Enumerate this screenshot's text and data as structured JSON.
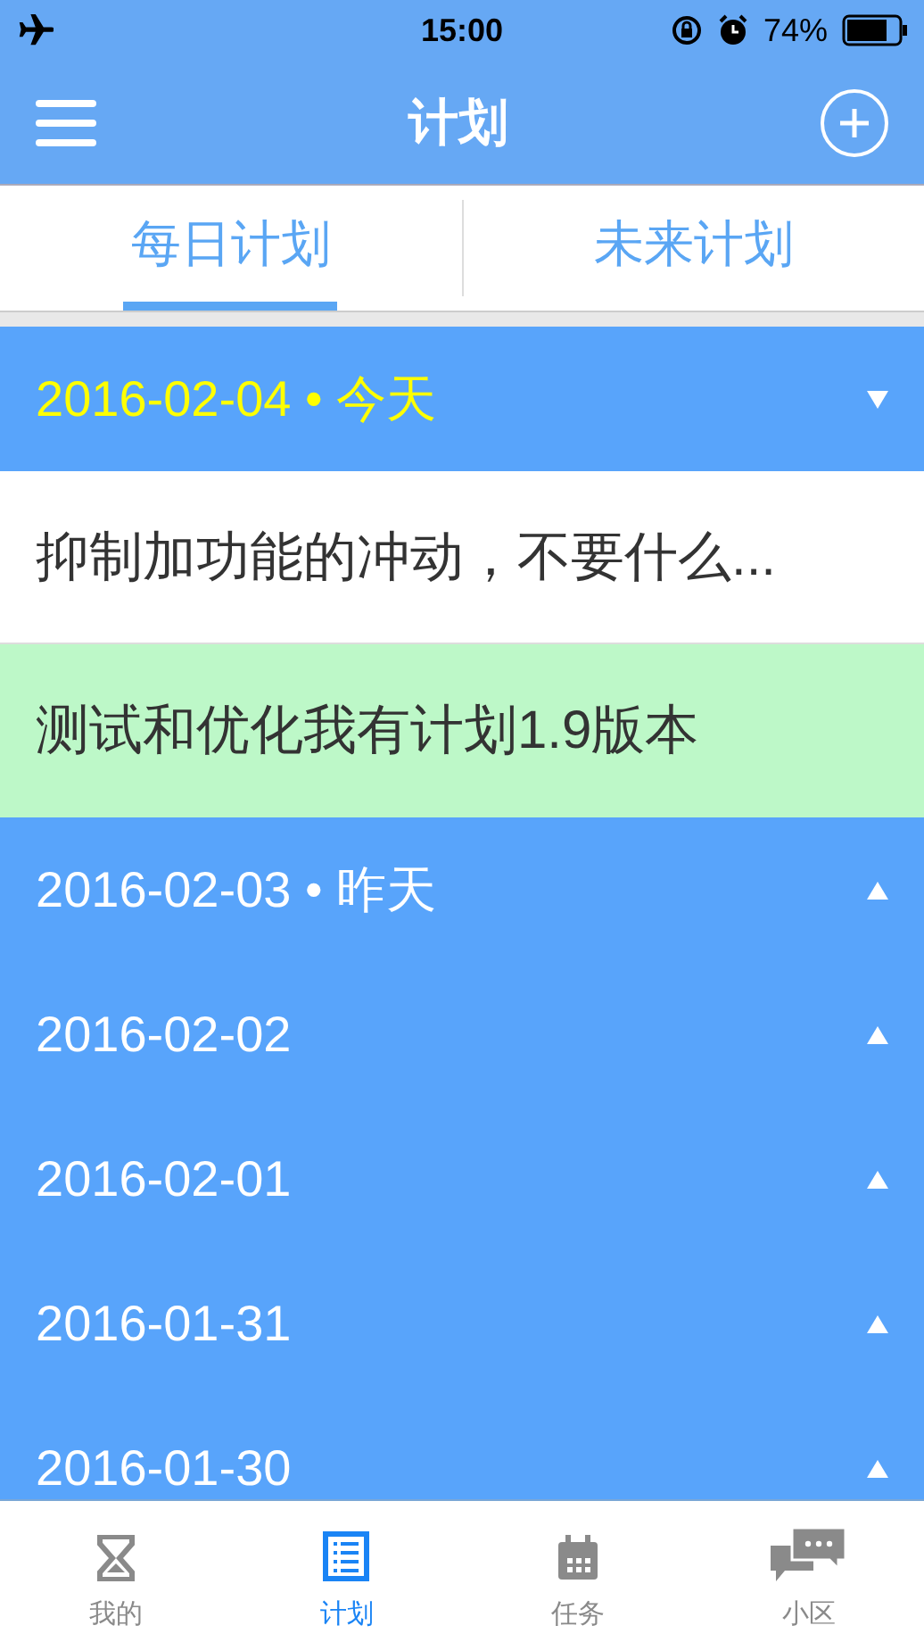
{
  "status_bar": {
    "time": "15:00",
    "battery": "74%"
  },
  "nav": {
    "title": "计划"
  },
  "tabs": [
    {
      "label": "每日计划",
      "selected": true
    },
    {
      "label": "未来计划",
      "selected": false
    }
  ],
  "days": [
    {
      "heading": "2016-02-04 • 今天",
      "today": true,
      "expanded": true,
      "plans": [
        {
          "text": "抑制加功能的冲动，不要什么...",
          "done": false
        },
        {
          "text": "测试和优化我有计划1.9版本",
          "done": true
        }
      ]
    },
    {
      "heading": "2016-02-03 • 昨天",
      "today": false,
      "expanded": false
    },
    {
      "heading": "2016-02-02",
      "today": false,
      "expanded": false
    },
    {
      "heading": "2016-02-01",
      "today": false,
      "expanded": false
    },
    {
      "heading": "2016-01-31",
      "today": false,
      "expanded": false
    },
    {
      "heading": "2016-01-30",
      "today": false,
      "expanded": false
    }
  ],
  "tab_bar": [
    {
      "kind": "hourglass",
      "label": "我的",
      "selected": false
    },
    {
      "kind": "list",
      "label": "计划",
      "selected": true
    },
    {
      "kind": "calendar",
      "label": "任务",
      "selected": false
    },
    {
      "kind": "chat",
      "label": "小区",
      "selected": false
    }
  ]
}
